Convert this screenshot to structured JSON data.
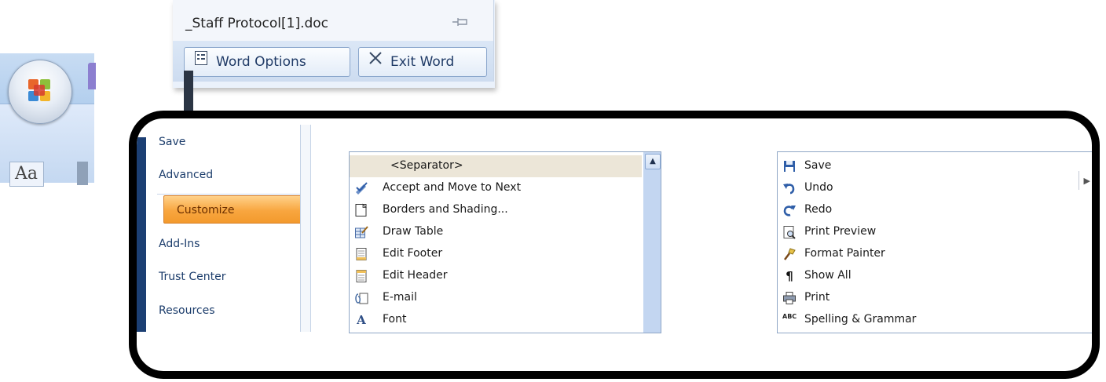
{
  "office_menu": {
    "recent_doc": "_Staff Protocol[1].doc",
    "word_options_label": "Word Options",
    "exit_word_label": "Exit Word",
    "icons": {
      "pin": "pin-icon",
      "options": "options-icon",
      "exit": "close-icon"
    }
  },
  "ribbon_fragment": {
    "font_button_text": "Aa"
  },
  "word_options": {
    "nav": [
      {
        "label": "Save"
      },
      {
        "label": "Advanced"
      },
      {
        "label": "Customize",
        "active": true
      },
      {
        "label": "Add-Ins"
      },
      {
        "label": "Trust Center"
      },
      {
        "label": "Resources"
      }
    ],
    "available_commands": [
      {
        "label": "<Separator>",
        "icon": "none",
        "selected": true
      },
      {
        "label": "Accept and Move to Next",
        "icon": "accept-change-icon"
      },
      {
        "label": "Borders and Shading...",
        "icon": "borders-icon"
      },
      {
        "label": "Draw Table",
        "icon": "draw-table-icon"
      },
      {
        "label": "Edit Footer",
        "icon": "footer-icon"
      },
      {
        "label": "Edit Header",
        "icon": "header-icon"
      },
      {
        "label": "E-mail",
        "icon": "email-icon"
      },
      {
        "label": "Font",
        "icon": "font-icon"
      }
    ],
    "quick_access_commands": [
      {
        "label": "Save",
        "icon": "save-icon"
      },
      {
        "label": "Undo",
        "icon": "undo-icon"
      },
      {
        "label": "Redo",
        "icon": "redo-icon"
      },
      {
        "label": "Print Preview",
        "icon": "print-preview-icon"
      },
      {
        "label": "Format Painter",
        "icon": "format-painter-icon"
      },
      {
        "label": "Show All",
        "icon": "pilcrow-icon"
      },
      {
        "label": "Print",
        "icon": "printer-icon"
      },
      {
        "label": "Spelling & Grammar",
        "icon": "spelling-icon"
      }
    ]
  },
  "colors": {
    "accent_active": "#f8a63f",
    "nav_text": "#1b3c6b",
    "selection_bg": "#ece6d8",
    "outline": "#000000"
  }
}
